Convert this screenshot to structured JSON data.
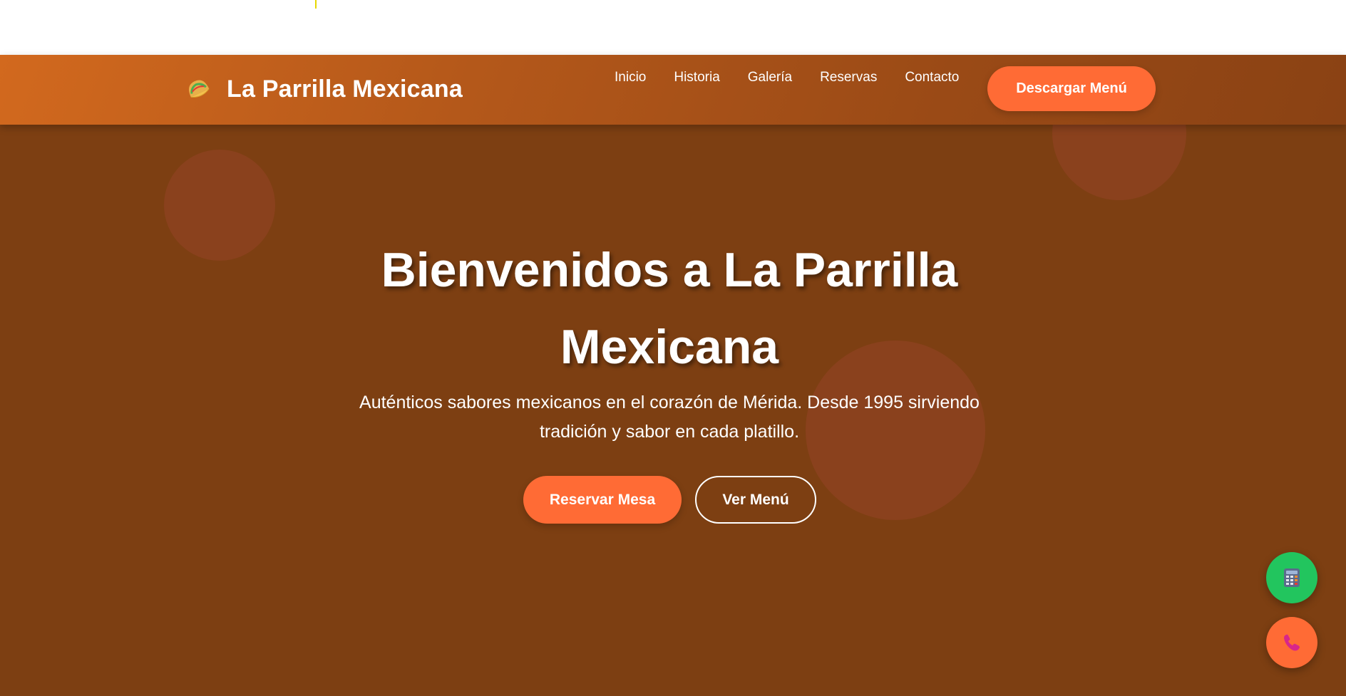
{
  "brand": {
    "name": "La Parrilla Mexicana",
    "icon": "taco-icon"
  },
  "nav": {
    "links": [
      "Inicio",
      "Historia",
      "Galería",
      "Reservas",
      "Contacto"
    ],
    "cta_label": "Descargar Menú"
  },
  "hero": {
    "title_line1": "Bienvenidos a La Parrilla",
    "title_line2": "Mexicana",
    "subtitle_line1": "Auténticos sabores mexicanos en el corazón de Mérida. Desde 1995 sirviendo",
    "subtitle_line2": "tradición y sabor en cada platillo.",
    "primary_button": "Reservar Mesa",
    "secondary_button": "Ver Menú"
  },
  "floating_buttons": {
    "calculator_icon": "calculator-icon",
    "phone_icon": "phone-icon"
  },
  "colors": {
    "accent": "#ff6b35",
    "hero_background": "#7d3f12",
    "navbar_start": "#d2691e",
    "navbar_end": "#8a4214",
    "fab_green": "#22c55e"
  }
}
